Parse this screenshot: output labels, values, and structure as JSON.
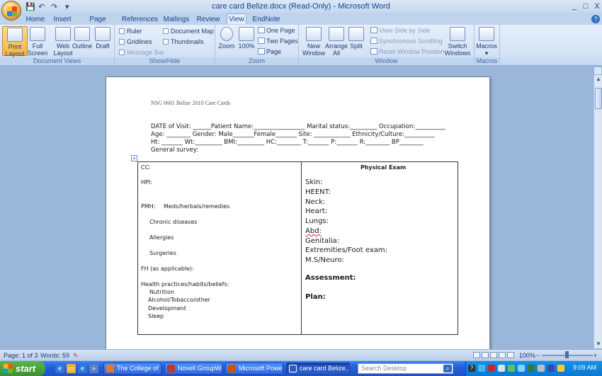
{
  "window": {
    "title": "care card Belize.docx (Read-Only) - Microsoft Word",
    "controls": {
      "minimize": "_",
      "maximize": "□",
      "close": "X"
    }
  },
  "quick_access": {
    "save": "💾",
    "undo": "↶",
    "redo": "↷",
    "customize": "▾"
  },
  "tabs": [
    "Home",
    "Insert",
    "Page Layout",
    "References",
    "Mailings",
    "Review",
    "View",
    "EndNote"
  ],
  "active_tab": "View",
  "ribbon": {
    "document_views": {
      "label": "Document Views",
      "buttons": [
        "Print\nLayout",
        "Full Screen\nReading",
        "Web\nLayout",
        "Outline",
        "Draft"
      ]
    },
    "show_hide": {
      "label": "Show/Hide",
      "checkboxes": [
        "Ruler",
        "Document Map",
        "Gridlines",
        "Thumbnails",
        "Message Bar"
      ]
    },
    "zoom": {
      "label": "Zoom",
      "zoom_btn": "Zoom",
      "hundred_btn": "100%",
      "one_page": "One Page",
      "two_pages": "Two Pages",
      "page_width": "Page Width"
    },
    "window": {
      "label": "Window",
      "new_window": "New\nWindow",
      "arrange_all": "Arrange\nAll",
      "split": "Split",
      "side_by_side": "View Side by Side",
      "sync_scrolling": "Synchronous Scrolling",
      "reset_position": "Reset Window Position",
      "switch_windows": "Switch\nWindows ▾"
    },
    "macros": {
      "label": "Macros",
      "button": "Macros\n▾"
    }
  },
  "document": {
    "header": "NSG 6681 Belize 2010 Care Cards",
    "form_lines": [
      "DATE of Visit: ______Patient Name:_________________ Marital status:_________ Occupation:__________",
      "Age: ________  Gender:  Male_______Female_______ Site: ____________ Ethnicity/Culture:__________",
      "Ht: _______  Wt:_________ BMI:_________ HC:________ T:_______ P:_______ R:________ BP________",
      "General survey:"
    ],
    "left_column": {
      "cc": "CC:",
      "hpi": "HPI:",
      "pmh": "PMH:",
      "meds": "Meds/herbals/remedies",
      "chronic": "Chronic diseases",
      "allergies": "Allergies",
      "surgeries": "Surgeries",
      "fh": "FH (as applicable):",
      "health_practices": "Health practices/habits/beliefs:",
      "nutrition": "Nutrition",
      "alcohol": "Alcohol/Tobacco/other",
      "development": "Development",
      "sleep": "Sleep"
    },
    "right_column": {
      "heading": "Physical Exam",
      "items": [
        "Skin:",
        "HEENT:",
        "Neck:",
        "Heart:",
        "Lungs:",
        "Abd:",
        "Genitalia:",
        "Extremities/Foot exam:",
        "M.S/Neuro:"
      ],
      "assessment": "Assessment:",
      "plan": "Plan:"
    }
  },
  "statusbar": {
    "page": "Page: 1 of 3",
    "words": "Words: 59",
    "zoom": "100%"
  },
  "taskbar": {
    "start": "start",
    "tasks": [
      "The College of ...",
      "Novell GroupWi...",
      "Microsoft Powe...",
      "care card Belize..."
    ],
    "active_task": "care card Belize...",
    "search_placeholder": "Search Desktop",
    "clock": "9:09 AM"
  }
}
